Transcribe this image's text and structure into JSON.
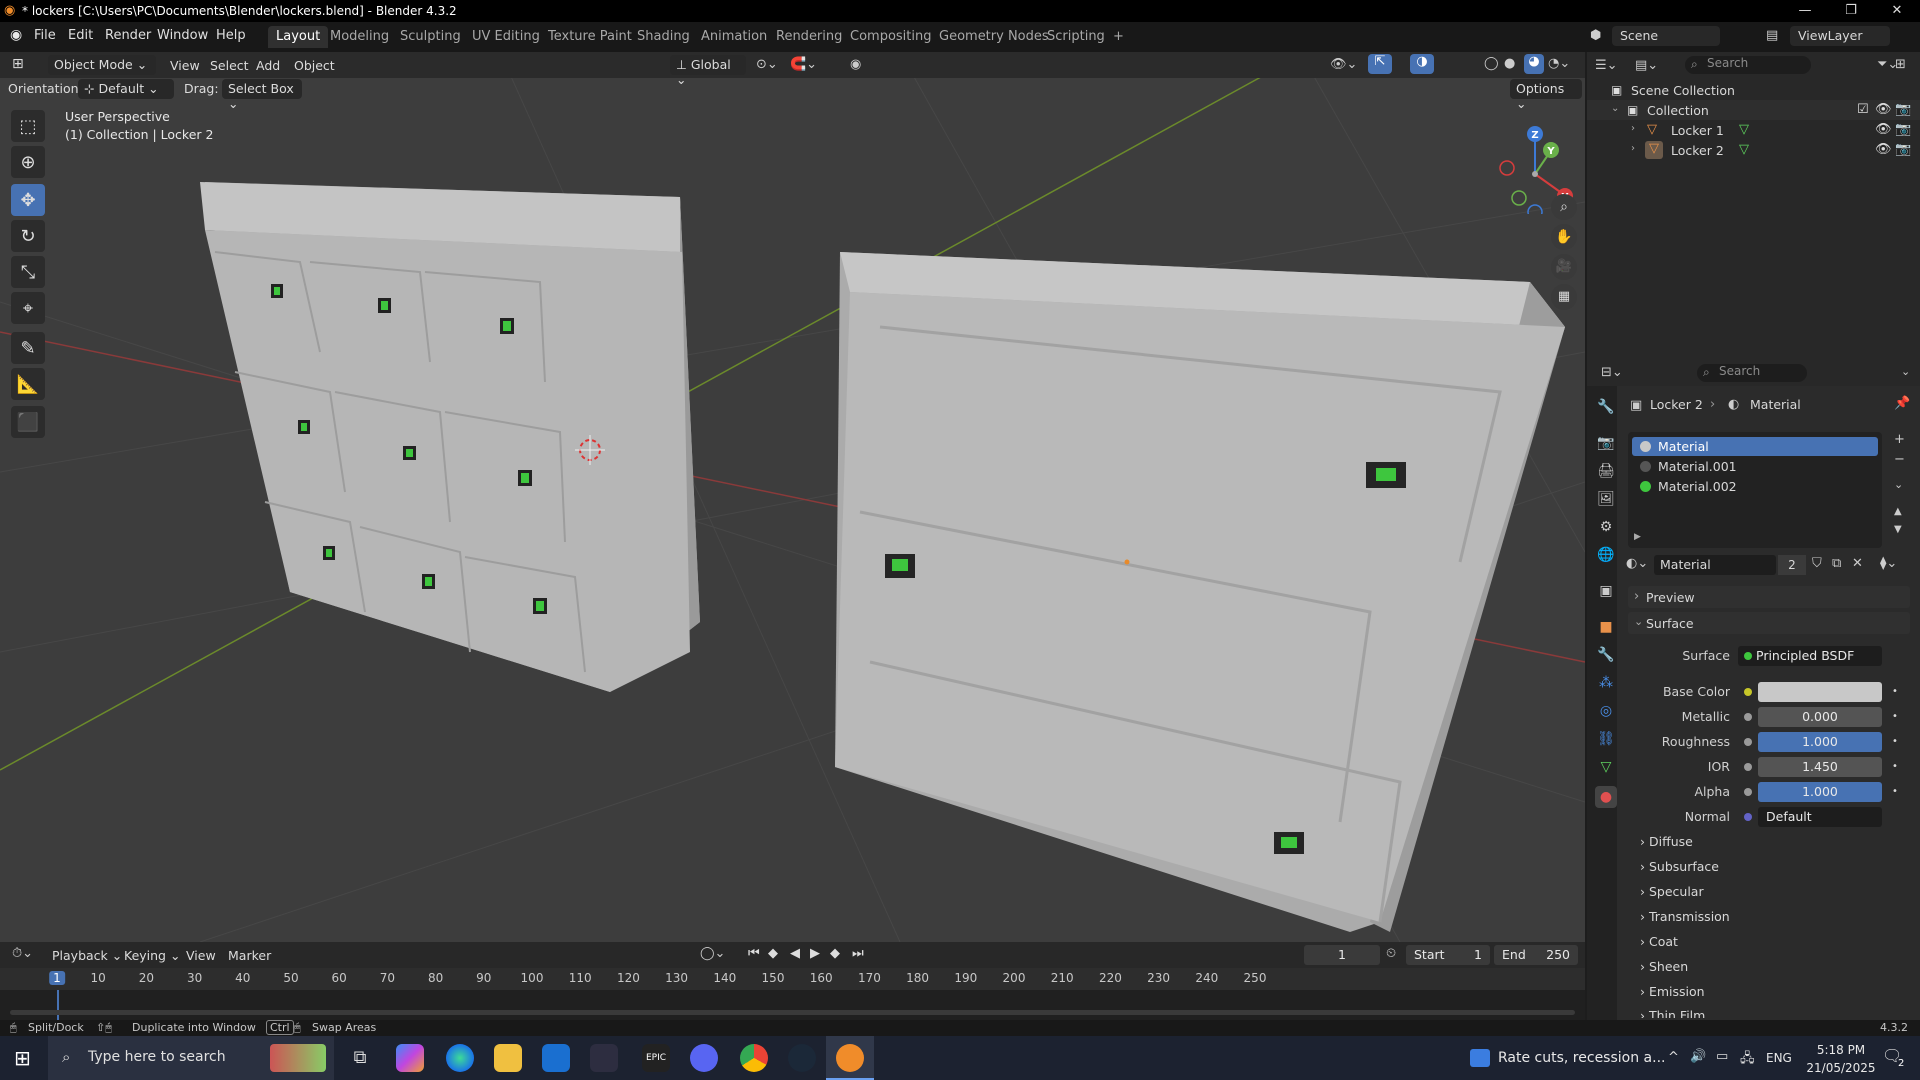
{
  "window": {
    "title": "* lockers [C:\\Users\\PC\\Documents\\Blender\\lockers.blend] - Blender 4.3.2",
    "minimize": "—",
    "maximize": "❐",
    "close": "✕"
  },
  "menu": [
    "File",
    "Edit",
    "Render",
    "Window",
    "Help"
  ],
  "workspaces": [
    "Layout",
    "Modeling",
    "Sculpting",
    "UV Editing",
    "Texture Paint",
    "Shading",
    "Animation",
    "Rendering",
    "Compositing",
    "Geometry Nodes",
    "Scripting"
  ],
  "workspace_add": "+",
  "scene": {
    "label": "Scene",
    "viewlayer": "ViewLayer"
  },
  "viewport_header": {
    "mode": "Object Mode",
    "menus": [
      "View",
      "Select",
      "Add",
      "Object"
    ],
    "transform": "Global"
  },
  "tool_header": {
    "orientation_label": "Orientation:",
    "orientation_value": "Default",
    "drag_label": "Drag:",
    "drag_value": "Select Box",
    "options": "Options"
  },
  "viewport": {
    "perspective": "User Perspective",
    "collection_info": "(1) Collection | Locker 2",
    "gizmo_axes": [
      "X",
      "Y",
      "Z"
    ]
  },
  "outliner": {
    "search_placeholder": "Search",
    "root": "Scene Collection",
    "collection": "Collection",
    "items": [
      "Locker 1",
      "Locker 2"
    ]
  },
  "properties": {
    "search_placeholder": "Search",
    "breadcrumb_object": "Locker 2",
    "breadcrumb_tab": "Material",
    "materials": [
      {
        "name": "Material",
        "color": "#c8c8c8",
        "selected": true
      },
      {
        "name": "Material.001",
        "color": "#555555",
        "selected": false
      },
      {
        "name": "Material.002",
        "color": "#3ec63e",
        "selected": false
      }
    ],
    "material_name": "Material",
    "users": "2",
    "sections": {
      "preview": "Preview",
      "surface": "Surface"
    },
    "surface": {
      "surface_label": "Surface",
      "surface_value": "Principled BSDF",
      "base_color_label": "Base Color",
      "metallic_label": "Metallic",
      "metallic": "0.000",
      "roughness_label": "Roughness",
      "roughness": "1.000",
      "ior_label": "IOR",
      "ior": "1.450",
      "alpha_label": "Alpha",
      "alpha": "1.000",
      "normal_label": "Normal",
      "normal": "Default"
    },
    "subsections": [
      "Diffuse",
      "Subsurface",
      "Specular",
      "Transmission",
      "Coat",
      "Sheen",
      "Emission",
      "Thin Film"
    ]
  },
  "timeline": {
    "menus": [
      "Playback",
      "Keying",
      "View",
      "Marker"
    ],
    "current_frame": "1",
    "start_label": "Start",
    "start": "1",
    "end_label": "End",
    "end": "250",
    "ruler": [
      "1",
      "10",
      "20",
      "30",
      "40",
      "50",
      "60",
      "70",
      "80",
      "90",
      "100",
      "110",
      "120",
      "130",
      "140",
      "150",
      "160",
      "170",
      "180",
      "190",
      "200",
      "210",
      "220",
      "230",
      "240",
      "250"
    ]
  },
  "statusbar": {
    "split": "Split/Dock",
    "duplicate": "Duplicate into Window",
    "ctrl": "Ctrl",
    "swap": "Swap Areas",
    "version": "4.3.2"
  },
  "taskbar": {
    "search_placeholder": "Type here to search",
    "news": "Rate cuts, recession a...",
    "lang": "ENG",
    "time": "5:18 PM",
    "date": "21/05/2025",
    "notifications": "2"
  },
  "colors": {
    "accent": "#4772b3",
    "viewport_bg": "#3d3d3d",
    "locker": "#bdbdbd",
    "green": "#3ec63e"
  }
}
